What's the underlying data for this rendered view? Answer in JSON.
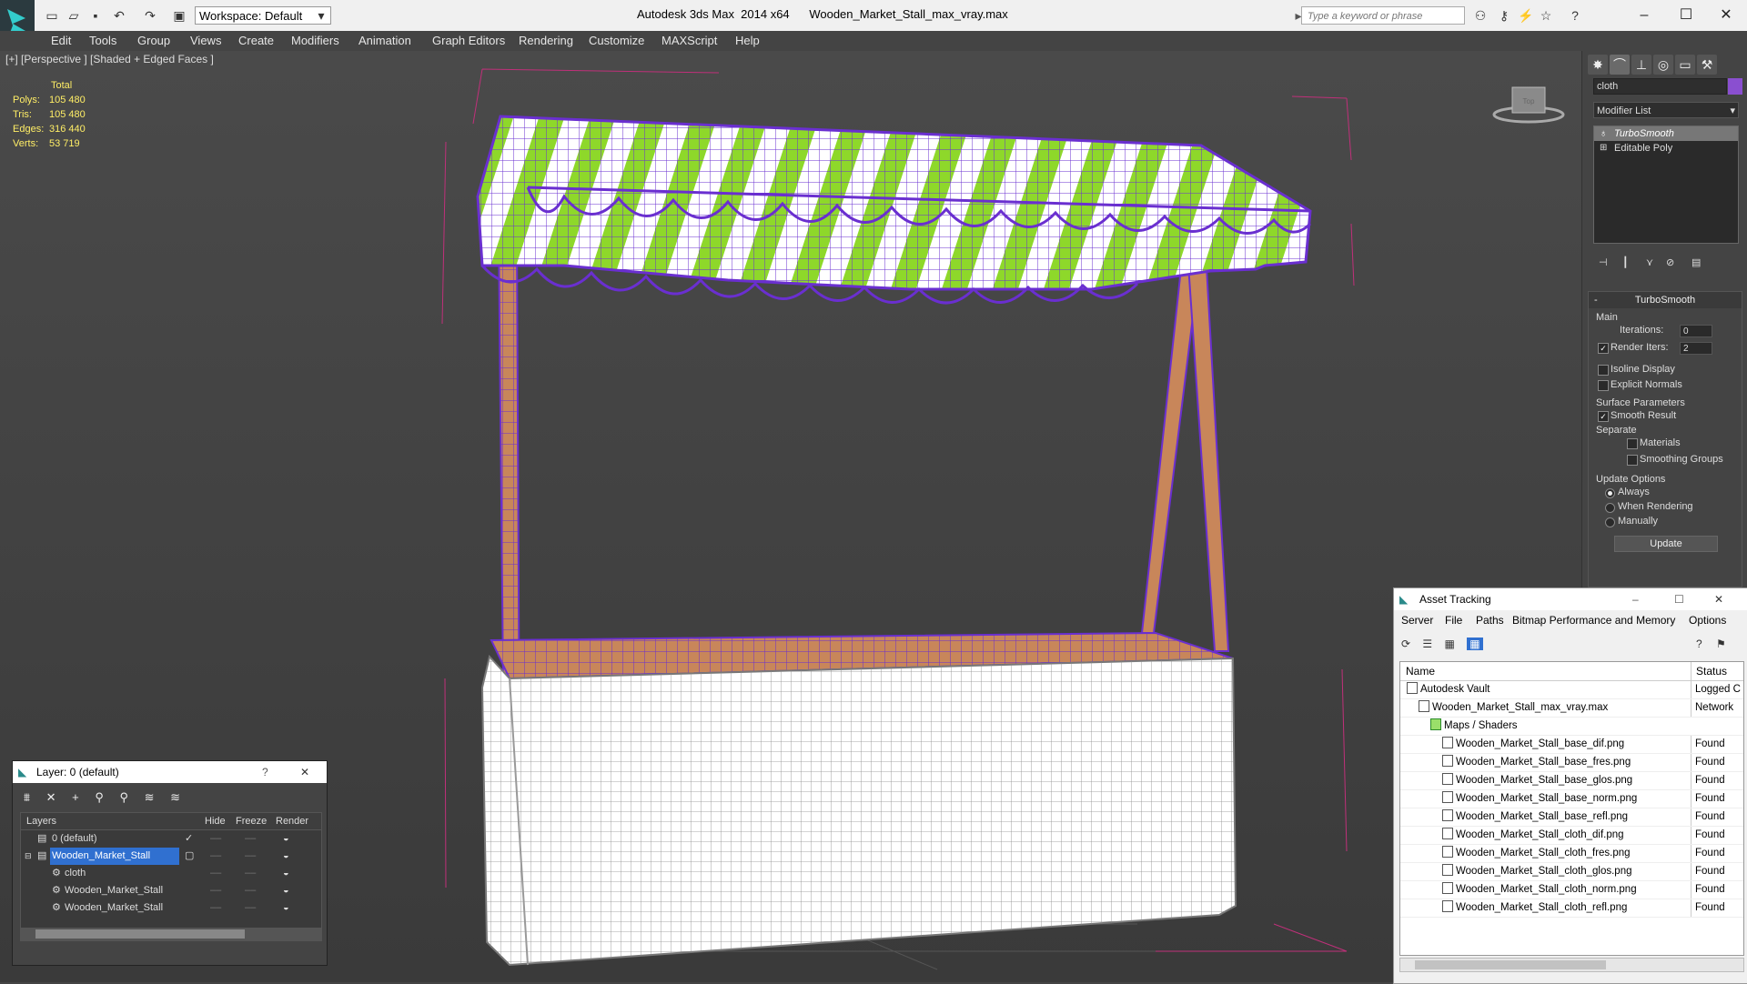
{
  "app": {
    "title": "Autodesk 3ds Max  2014 x64      Wooden_Market_Stall_max_vray.max",
    "workspace": "Workspace: Default",
    "search_placeholder": "Type a keyword or phrase"
  },
  "menu": [
    "Edit",
    "Tools",
    "Group",
    "Views",
    "Create",
    "Modifiers",
    "Animation",
    "Graph Editors",
    "Rendering",
    "Customize",
    "MAXScript",
    "Help"
  ],
  "viewport": {
    "label": "[+] [Perspective ] [Shaded + Edged Faces ]",
    "viewcube_label": "Top",
    "stats": {
      "header": "Total",
      "rows": [
        {
          "k": "Polys:",
          "v": "105 480"
        },
        {
          "k": "Tris:",
          "v": "105 480"
        },
        {
          "k": "Edges:",
          "v": "316 440"
        },
        {
          "k": "Verts:",
          "v": "53 719"
        }
      ]
    },
    "colors": {
      "wire": "#6a2fd0",
      "stripe_green": "#8ed82a",
      "cloth": "#ffffff",
      "wood": "#c8865a"
    }
  },
  "command_panel": {
    "object_name": "cloth",
    "object_color": "#8a4fd0",
    "modifier_list": "Modifier List",
    "stack": [
      "TurboSmooth",
      "Editable Poly"
    ],
    "turbosmooth": {
      "title": "TurboSmooth",
      "main": "Main",
      "iterations_label": "Iterations:",
      "iterations": "0",
      "render_iters_label": "Render Iters:",
      "render_iters": "2",
      "isoline": "Isoline Display",
      "explicit": "Explicit Normals",
      "surface": "Surface Parameters",
      "smooth_result": "Smooth Result",
      "separate": "Separate",
      "materials": "Materials",
      "smoothing_groups": "Smoothing Groups",
      "update_options": "Update Options",
      "always": "Always",
      "when_rendering": "When Rendering",
      "manually": "Manually",
      "update": "Update"
    }
  },
  "layer_dialog": {
    "title": "Layer: 0 (default)",
    "help": "?",
    "columns": [
      "Layers",
      "Hide",
      "Freeze",
      "Render"
    ],
    "rows": [
      {
        "name": "0 (default)",
        "indent": 1,
        "current": true
      },
      {
        "name": "Wooden_Market_Stall",
        "indent": 1,
        "selected": true
      },
      {
        "name": "cloth",
        "indent": 2
      },
      {
        "name": "Wooden_Market_Stall",
        "indent": 2
      },
      {
        "name": "Wooden_Market_Stall",
        "indent": 2
      }
    ]
  },
  "asset_tracking": {
    "title": "Asset Tracking",
    "menu": [
      "Server",
      "File",
      "Paths",
      "Bitmap Performance and Memory",
      "Options"
    ],
    "columns": [
      "Name",
      "Status"
    ],
    "rows": [
      {
        "name": "Autodesk Vault",
        "indent": 1,
        "status": "Logged C"
      },
      {
        "name": "Wooden_Market_Stall_max_vray.max",
        "indent": 2,
        "status": "Network"
      },
      {
        "name": "Maps / Shaders",
        "indent": 3,
        "status": ""
      },
      {
        "name": "Wooden_Market_Stall_base_dif.png",
        "indent": 4,
        "status": "Found"
      },
      {
        "name": "Wooden_Market_Stall_base_fres.png",
        "indent": 4,
        "status": "Found"
      },
      {
        "name": "Wooden_Market_Stall_base_glos.png",
        "indent": 4,
        "status": "Found"
      },
      {
        "name": "Wooden_Market_Stall_base_norm.png",
        "indent": 4,
        "status": "Found"
      },
      {
        "name": "Wooden_Market_Stall_base_refl.png",
        "indent": 4,
        "status": "Found"
      },
      {
        "name": "Wooden_Market_Stall_cloth_dif.png",
        "indent": 4,
        "status": "Found"
      },
      {
        "name": "Wooden_Market_Stall_cloth_fres.png",
        "indent": 4,
        "status": "Found"
      },
      {
        "name": "Wooden_Market_Stall_cloth_glos.png",
        "indent": 4,
        "status": "Found"
      },
      {
        "name": "Wooden_Market_Stall_cloth_norm.png",
        "indent": 4,
        "status": "Found"
      },
      {
        "name": "Wooden_Market_Stall_cloth_refl.png",
        "indent": 4,
        "status": "Found"
      }
    ]
  }
}
